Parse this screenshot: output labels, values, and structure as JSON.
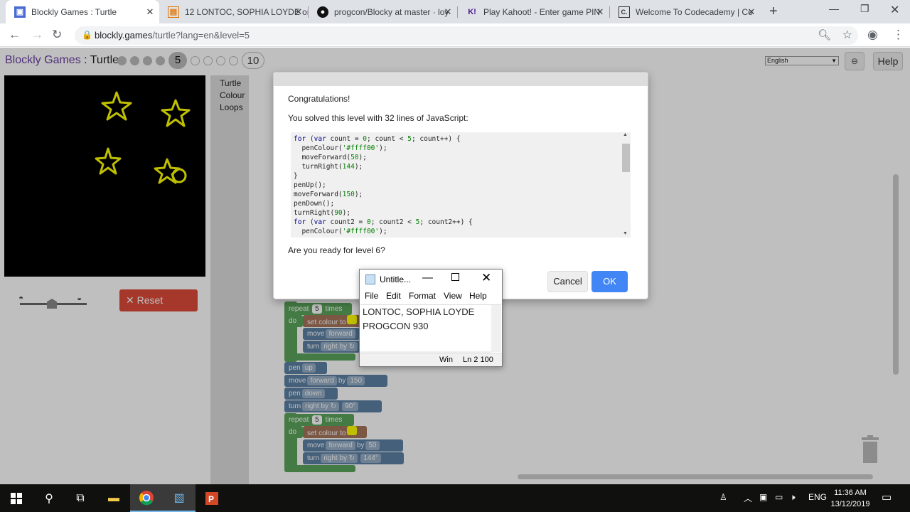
{
  "browser": {
    "tabs": [
      {
        "title": "Blockly Games : Turtle",
        "favicon": "blockly-icon",
        "active": true
      },
      {
        "title": "12 LONTOC, SOPHIA LOYDE or",
        "favicon": "classroom-icon",
        "active": false
      },
      {
        "title": "progcon/Blocky at master · loy",
        "favicon": "github-icon",
        "active": false
      },
      {
        "title": "Play Kahoot! - Enter game PIN",
        "favicon": "kahoot-icon",
        "active": false
      },
      {
        "title": "Welcome To Codecademy | Co",
        "favicon": "codecademy-icon",
        "active": false
      }
    ],
    "url_domain": "blockly.games",
    "url_path": "/turtle?lang=en&level=5"
  },
  "app": {
    "title": "Blockly Games",
    "separator": " : ",
    "subtitle": "Turtle",
    "current_level": "5",
    "max_level": "10",
    "levels_done": 4,
    "language": "English",
    "help": "Help",
    "reset": "Reset",
    "toolbox": [
      "Turtle",
      "Colour",
      "Loops"
    ]
  },
  "dialog": {
    "heading": "Congratulations!",
    "message": "You solved this level with 32 lines of JavaScript:",
    "code_lines": [
      "for (var count = 0; count < 5; count++) {",
      "  penColour('#ffff00');",
      "  moveForward(50);",
      "  turnRight(144);",
      "}",
      "penUp();",
      "moveForward(150);",
      "penDown();",
      "turnRight(90);",
      "for (var count2 = 0; count2 < 5; count2++) {",
      "  penColour('#ffff00');"
    ],
    "question": "Are you ready for level 6?",
    "cancel": "Cancel",
    "ok": "OK"
  },
  "blocks": {
    "repeat": "repeat",
    "times": "times",
    "do": "do",
    "set_colour": "set colour to",
    "move": "move",
    "forward": "forward",
    "by": "by",
    "turn": "turn",
    "right_by": "right by ↻",
    "pen": "pen",
    "up": "up",
    "down": "down",
    "repeat_count": "5",
    "move_short": "50",
    "move_long": "150",
    "turn_star": "144°",
    "turn_90": "90°"
  },
  "notepad": {
    "title": "Untitle...",
    "menu": [
      "File",
      "Edit",
      "Format",
      "View",
      "Help"
    ],
    "lines": [
      "LONTOC, SOPHIA LOYDE",
      "PROGCON 930"
    ],
    "status_win": "Win",
    "status_pos": "Ln 2 100"
  },
  "taskbar": {
    "lang": "ENG",
    "time": "11:36 AM",
    "date": "13/12/2019"
  },
  "colors": {
    "accent": "#4285f4",
    "reset": "#dd4b39",
    "loop_block": "#5ba55b",
    "pen_block": "#5b80a5",
    "colour_block": "#a5745b",
    "star": "#ffff00"
  }
}
